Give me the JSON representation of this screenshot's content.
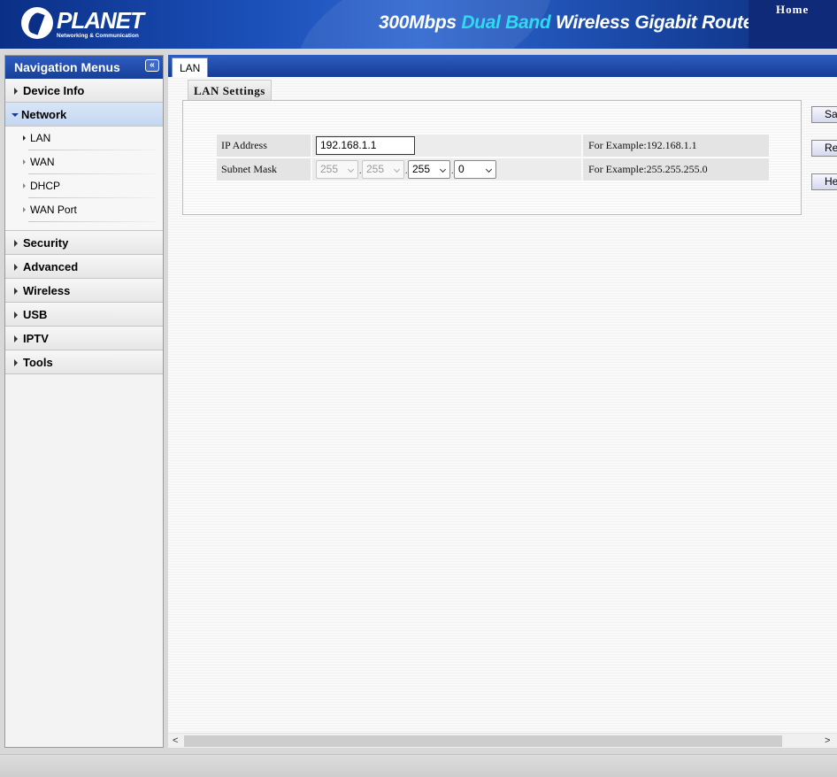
{
  "header": {
    "logo_name": "PLANET",
    "logo_sub": "Networking & Communication",
    "product_pre": "300Mbps ",
    "product_accent": "Dual Band",
    "product_post": " Wireless Gigabit Route",
    "home_label": "Home"
  },
  "sidebar": {
    "title": "Navigation Menus",
    "collapse_icon": "«",
    "items": [
      {
        "label": "Device Info"
      },
      {
        "label": "Network",
        "expanded": true
      },
      {
        "label": "Security"
      },
      {
        "label": "Advanced"
      },
      {
        "label": "Wireless"
      },
      {
        "label": "USB"
      },
      {
        "label": "IPTV"
      },
      {
        "label": "Tools"
      }
    ],
    "network_sub": [
      {
        "label": "LAN",
        "active": true
      },
      {
        "label": "WAN"
      },
      {
        "label": "DHCP"
      },
      {
        "label": "WAN Port"
      }
    ]
  },
  "tabs": {
    "active": "LAN"
  },
  "section": {
    "title": "LAN Settings"
  },
  "form": {
    "ip_label": "IP Address",
    "ip_value": "192.168.1.1",
    "ip_example": "For Example:192.168.1.1",
    "mask_label": "Subnet Mask",
    "mask_octets": [
      "255",
      "255",
      "255",
      "0"
    ],
    "mask_example": "For Example:255.255.255.0"
  },
  "buttons": {
    "save": "Sa",
    "restore": "Res",
    "help": "He"
  },
  "scrollbar": {
    "left_arrow": "<",
    "right_arrow": ">"
  },
  "colors": {
    "header_blue": "#1b4fb8",
    "accent_cyan": "#2fd9f0",
    "nav_blue": "#2d5cc0"
  }
}
